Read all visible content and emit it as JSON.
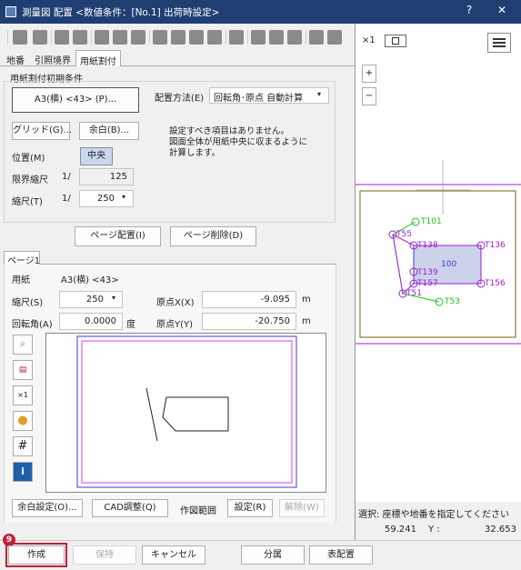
{
  "window": {
    "title": "測量図 配置 <数値条件：[No.1] 出荷時設定>",
    "help": "?",
    "close": "✕"
  },
  "tabs": [
    "地番",
    "引照境界",
    "用紙割付"
  ],
  "init": {
    "group_title": "用紙割付初期条件",
    "paper_button": "A3(横) <43> (P)...",
    "layout_method_label": "配置方法(E)",
    "layout_method_value": "回転角･原点 自動計算",
    "grid_button": "グリッド(G)...",
    "margin_button": "余白(B)...",
    "position_label": "位置(M)",
    "position_value": "中央",
    "limit_scale_label": "限界縮尺",
    "limit_scale_prefix": "1/",
    "limit_scale_value": "125",
    "scale_label": "縮尺(T)",
    "scale_prefix": "1/",
    "scale_value": "250",
    "info_lines": [
      "設定すべき項目はありません。",
      "図面全体が用紙中央に収まるように",
      "計算します。"
    ]
  },
  "page_buttons": {
    "place": "ページ配置(I)",
    "delete": "ページ削除(D)"
  },
  "page_tab": "ページ1",
  "page": {
    "paper_label": "用紙",
    "paper_value": "A3(横) <43>",
    "scale_label": "縮尺(S)",
    "scale_value": "250",
    "origin_x_label": "原点X(X)",
    "origin_x_value": "-9.095",
    "origin_x_unit": "m",
    "rotation_label": "回転角(A)",
    "rotation_value": "0.0000",
    "rotation_unit": "度",
    "origin_y_label": "原点Y(Y)",
    "origin_y_value": "-20.750",
    "origin_y_unit": "m"
  },
  "bottom_tools": {
    "margin_settings": "余白設定(O)...",
    "cad_adjust": "CAD調整(Q)",
    "drawing_range_label": "作図範囲",
    "range_set": "設定(R)",
    "range_clear": "解除(W)"
  },
  "footer": {
    "badge": "9",
    "create": "作成",
    "hold": "保持",
    "cancel": "キャンセル",
    "split": "分属",
    "table_layout": "表配置"
  },
  "right": {
    "zoom_x1": "×1",
    "plus": "+",
    "minus": "−",
    "points": [
      "T101",
      "T55",
      "T138",
      "T136",
      "100",
      "T139",
      "T157",
      "T156",
      "T51",
      "T53"
    ],
    "status": "選択: 座標や地番を指定してください",
    "coord_x": "59.241",
    "coord_y_label": "Y :",
    "coord_y": "32.653"
  },
  "colors": {
    "titlebar": "#1f3f73",
    "accent_red": "#c0203a",
    "plot_purple": "#9b20d0",
    "plot_green": "#1fbf1f",
    "frame_olive": "#8a7d3c"
  }
}
